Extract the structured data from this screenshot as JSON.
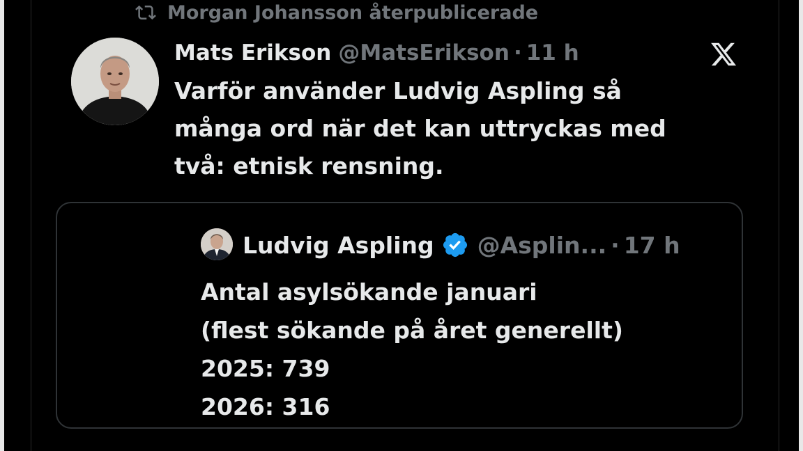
{
  "repost": {
    "icon": "repost-icon",
    "text": "Morgan Johansson återpublicerade"
  },
  "tweet": {
    "author_name": "Mats Erikson",
    "handle": "@MatsErikson",
    "separator": "·",
    "time": "11 h",
    "text_lines": [
      "Varför använder Ludvig Aspling så",
      "många ord när det kan uttryckas med",
      "två: etnisk rensning."
    ]
  },
  "quote": {
    "author_name": "Ludvig Aspling",
    "verified_icon": "verified-badge-icon",
    "handle": "@Asplin...",
    "separator": "·",
    "time": "17 h",
    "text_lines": [
      "Antal asylsökande januari",
      "(flest sökande på året generellt)",
      "2025: 739",
      "2026: 316"
    ]
  },
  "colors": {
    "background": "#000000",
    "text_primary": "#e7e9ea",
    "text_secondary": "#71767b",
    "verified_blue": "#1d9bf0",
    "border": "#2f3336"
  }
}
